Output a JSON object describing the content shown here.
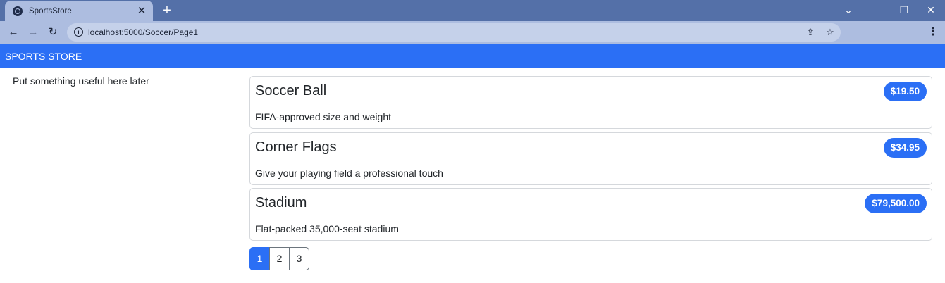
{
  "browser": {
    "tab": {
      "title": "SportsStore",
      "favicon": "globe-icon",
      "close": "✕"
    },
    "new_tab": "+",
    "window_controls": {
      "dropdown": "⌄",
      "minimize": "—",
      "restore": "❐",
      "close": "✕"
    },
    "nav": {
      "back": "←",
      "forward": "→",
      "reload": "↻"
    },
    "address_bar": {
      "url": "localhost:5000/Soccer/Page1",
      "info_icon": "i"
    },
    "icons": {
      "share": "⇪",
      "bookmark": "☆",
      "menu": "⋮"
    }
  },
  "navbar": {
    "brand": "SPORTS STORE",
    "color": "#2b6ff5"
  },
  "sidebar": {
    "text": "Put something useful here later"
  },
  "products": [
    {
      "name": "Soccer Ball",
      "price": "$19.50",
      "description": "FIFA-approved size and weight"
    },
    {
      "name": "Corner Flags",
      "price": "$34.95",
      "description": "Give your playing field a professional touch"
    },
    {
      "name": "Stadium",
      "price": "$79,500.00",
      "description": "Flat-packed 35,000-seat stadium"
    }
  ],
  "pagination": {
    "pages": [
      "1",
      "2",
      "3"
    ],
    "active": "1"
  }
}
